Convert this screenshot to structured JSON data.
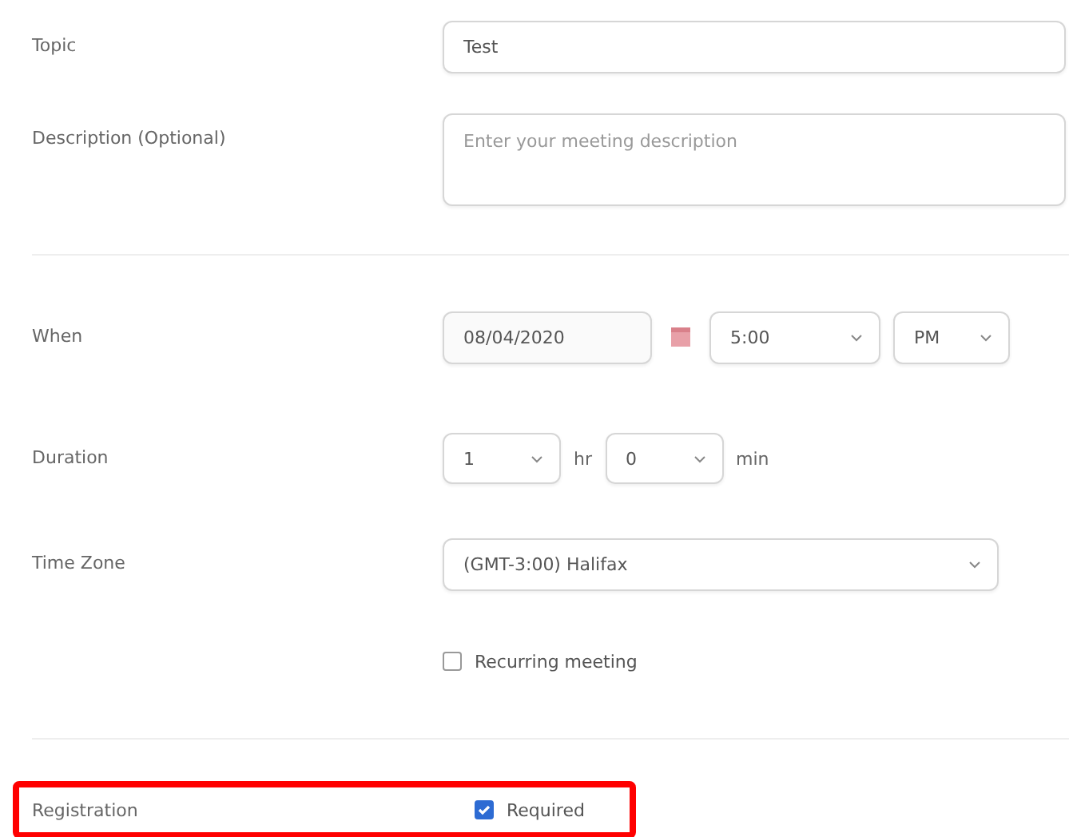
{
  "topic": {
    "label": "Topic",
    "value": "Test"
  },
  "description": {
    "label": "Description (Optional)",
    "placeholder": "Enter your meeting description"
  },
  "when": {
    "label": "When",
    "date": "08/04/2020",
    "time": "5:00",
    "ampm": "PM"
  },
  "duration": {
    "label": "Duration",
    "hours": "1",
    "hours_unit": "hr",
    "minutes": "0",
    "minutes_unit": "min"
  },
  "time_zone": {
    "label": "Time Zone",
    "value": "(GMT-3:00) Halifax"
  },
  "recurring": {
    "label": "Recurring meeting",
    "checked": false
  },
  "registration": {
    "label": "Registration",
    "option": "Required",
    "checked": true,
    "highlighted": true
  }
}
